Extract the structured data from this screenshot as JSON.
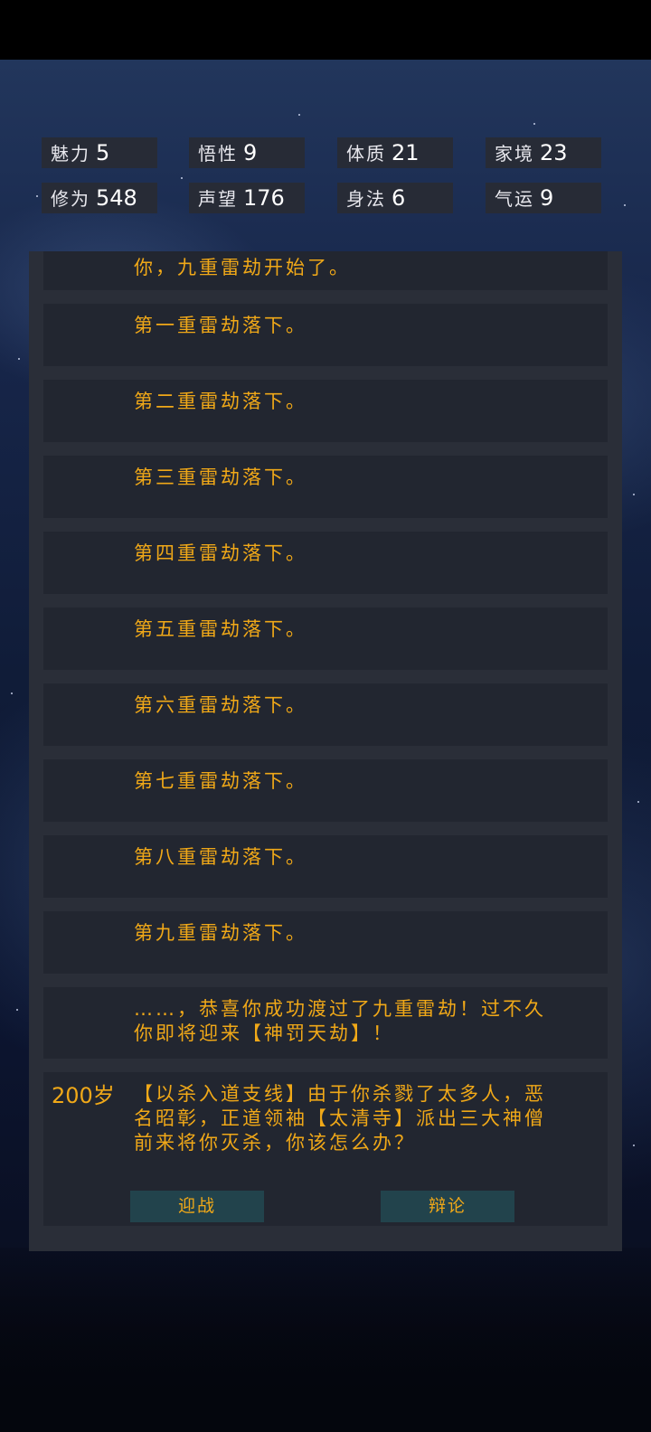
{
  "stats": [
    {
      "label": "魅力",
      "value": "5"
    },
    {
      "label": "悟性",
      "value": "9"
    },
    {
      "label": "体质",
      "value": "21"
    },
    {
      "label": "家境",
      "value": "23"
    },
    {
      "label": "修为",
      "value": "548"
    },
    {
      "label": "声望",
      "value": "176"
    },
    {
      "label": "身法",
      "value": "6"
    },
    {
      "label": "气运",
      "value": "9"
    }
  ],
  "log": [
    "你，九重雷劫开始了。",
    "第一重雷劫落下。",
    "第二重雷劫落下。",
    "第三重雷劫落下。",
    "第四重雷劫落下。",
    "第五重雷劫落下。",
    "第六重雷劫落下。",
    "第七重雷劫落下。",
    "第八重雷劫落下。",
    "第九重雷劫落下。"
  ],
  "congrats": {
    "line1": "……，恭喜你成功渡过了九重雷劫！过不久",
    "line2": "你即将迎来【神罚天劫】！"
  },
  "event": {
    "age": "200岁",
    "line1": "【以杀入道支线】由于你杀戮了太多人，恶",
    "line2": "名昭彰，正道领袖【太清寺】派出三大神僧",
    "line3": "前来将你灭杀，你该怎么办？",
    "choice_fight": "迎战",
    "choice_debate": "辩论"
  }
}
